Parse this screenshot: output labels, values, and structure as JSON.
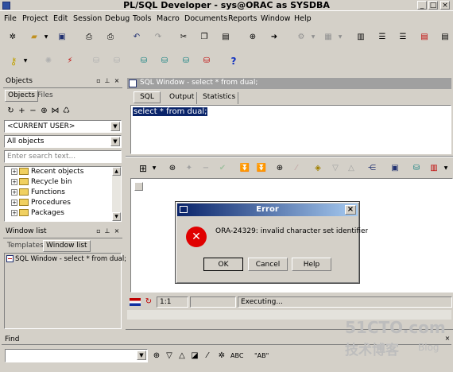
{
  "app": {
    "title": "PL/SQL Developer - sys@ORAC as SYSDBA",
    "min_glyph": "_",
    "max_glyph": "□",
    "close_glyph": "×"
  },
  "menu": [
    "File",
    "Project",
    "Edit",
    "Session",
    "Debug",
    "Tools",
    "Macro",
    "Documents",
    "Reports",
    "Window",
    "Help"
  ],
  "objects_panel": {
    "title": "Objects",
    "tabs": [
      "Objects",
      "Files"
    ],
    "user_combo": "<CURRENT USER>",
    "type_combo": "All objects",
    "search_placeholder": "Enter search text...",
    "tree": [
      "Recent objects",
      "Recycle bin",
      "Functions",
      "Procedures",
      "Packages"
    ]
  },
  "window_list_panel": {
    "title": "Window list",
    "tabs": [
      "Templates",
      "Window list"
    ],
    "items": [
      "SQL Window - select * from dual;"
    ]
  },
  "sql_window": {
    "title": "SQL Window - select * from dual;",
    "tabs": [
      "SQL",
      "Output",
      "Statistics"
    ],
    "query": "select * from dual;",
    "status_position": "1:1",
    "status_text": "Executing..."
  },
  "error_dialog": {
    "title": "Error",
    "message": "ORA-24329: invalid character set identifier",
    "ok": "OK",
    "cancel": "Cancel",
    "help": "Help",
    "close_glyph": "×",
    "error_glyph": "✕"
  },
  "find_bar": {
    "title": "Find",
    "text_abc": "ABC",
    "text_ab": "\"AB\""
  },
  "watermark": {
    "line1": "51CTO.com",
    "line2": "技术博客",
    "line3": "Blog"
  }
}
